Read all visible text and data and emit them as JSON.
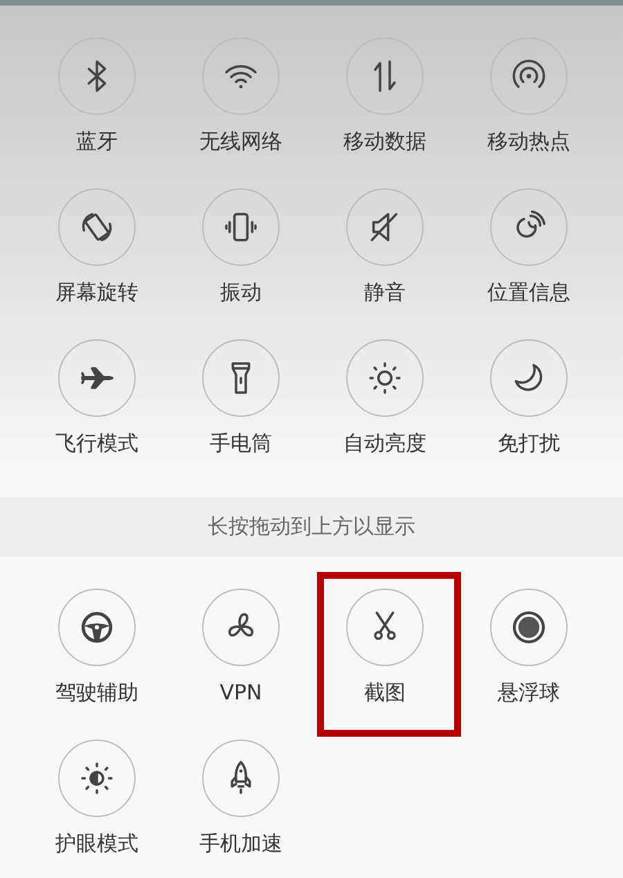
{
  "quick_toggles": [
    {
      "label": "蓝牙"
    },
    {
      "label": "无线网络"
    },
    {
      "label": "移动数据"
    },
    {
      "label": "移动热点"
    },
    {
      "label": "屏幕旋转"
    },
    {
      "label": "振动"
    },
    {
      "label": "静音"
    },
    {
      "label": "位置信息"
    },
    {
      "label": "飞行模式"
    },
    {
      "label": "手电筒"
    },
    {
      "label": "自动亮度"
    },
    {
      "label": "免打扰"
    }
  ],
  "hint": "长按拖动到上方以显示",
  "more_toggles": [
    {
      "label": "驾驶辅助",
      "highlighted": false
    },
    {
      "label": "VPN",
      "highlighted": false
    },
    {
      "label": "截图",
      "highlighted": true
    },
    {
      "label": "悬浮球",
      "highlighted": false
    },
    {
      "label": "护眼模式",
      "highlighted": false
    },
    {
      "label": "手机加速",
      "highlighted": false
    }
  ]
}
